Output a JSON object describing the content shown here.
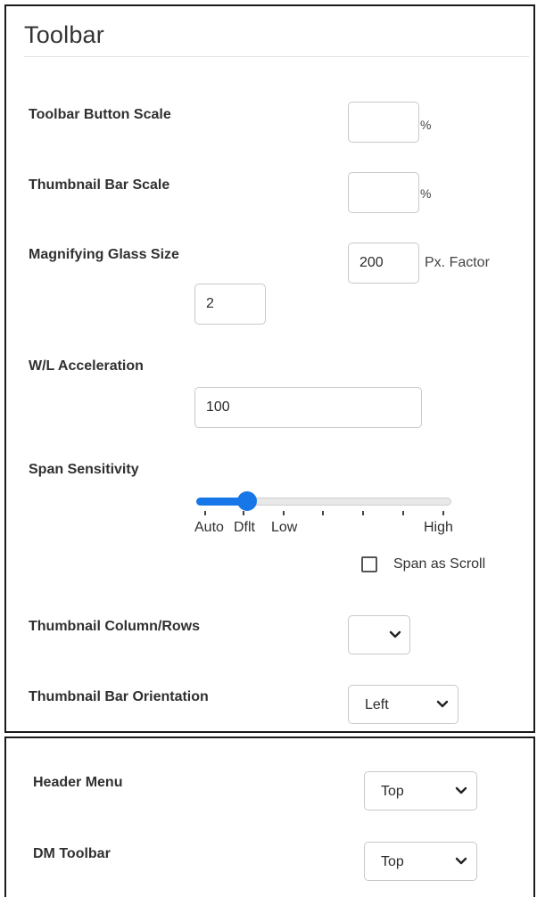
{
  "toolbar_section": {
    "title": "Toolbar",
    "toolbar_button_scale": {
      "label": "Toolbar Button Scale",
      "value": "",
      "unit": "%"
    },
    "thumbnail_bar_scale": {
      "label": "Thumbnail Bar Scale",
      "value": "",
      "unit": "%"
    },
    "magnifying_glass_size": {
      "label": "Magnifying Glass Size",
      "size_value": "200",
      "unit": "Px. Factor",
      "factor_value": "2"
    },
    "wl_acceleration": {
      "label": "W/L Acceleration",
      "value": "100"
    },
    "span_sensitivity": {
      "label": "Span Sensitivity",
      "ticks": [
        "Auto",
        "Dflt",
        "Low",
        "High"
      ],
      "selected": "Dflt",
      "slider_fraction": 0.2,
      "span_as_scroll": {
        "label": "Span as Scroll",
        "checked": false
      }
    },
    "thumbnail_column_rows": {
      "label": "Thumbnail Column/Rows",
      "selected": ""
    },
    "thumbnail_bar_orientation": {
      "label": "Thumbnail Bar Orientation",
      "selected": "Left"
    }
  },
  "menu_section": {
    "header_menu": {
      "label": "Header Menu",
      "selected": "Top"
    },
    "dm_toolbar": {
      "label": "DM Toolbar",
      "selected": "Top"
    }
  },
  "colors": {
    "accent": "#1877e8",
    "border": "#c9c9c9",
    "text": "#303030"
  }
}
